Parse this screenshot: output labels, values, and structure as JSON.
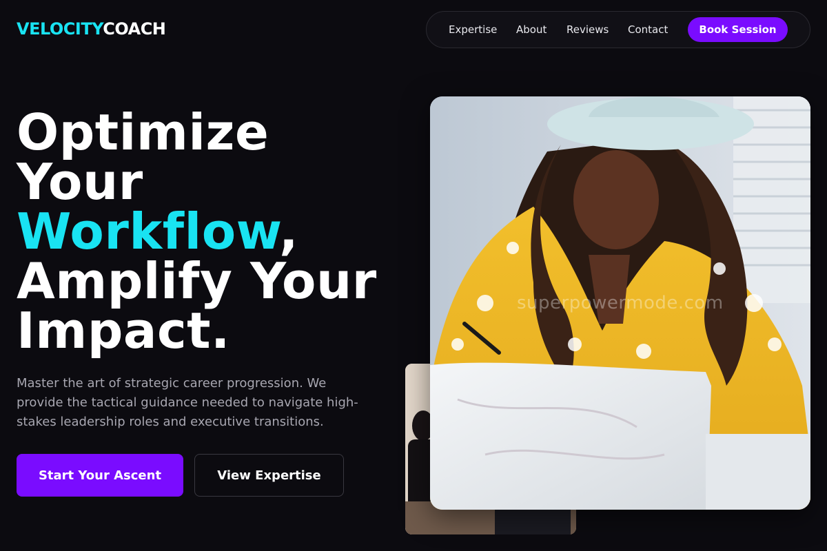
{
  "brand": {
    "part1": "VELOCITY",
    "part2": "COACH"
  },
  "nav": {
    "links": [
      "Expertise",
      "About",
      "Reviews",
      "Contact"
    ],
    "cta": "Book Session"
  },
  "hero": {
    "line1": "Optimize",
    "line2": "Your",
    "accent": "Workflow",
    "comma": ",",
    "line4": "Amplify Your",
    "line5": "Impact.",
    "subtitle": "Master the art of strategic career progression. We provide the tactical guidance needed to navigate high-stakes leadership roles and executive transitions.",
    "primary_cta": "Start Your Ascent",
    "secondary_cta": "View Expertise"
  },
  "image": {
    "watermark": "superpowermode.com"
  },
  "colors": {
    "background": "#0c0b10",
    "accent_cyan": "#19e3f2",
    "accent_purple": "#7a0cff"
  }
}
